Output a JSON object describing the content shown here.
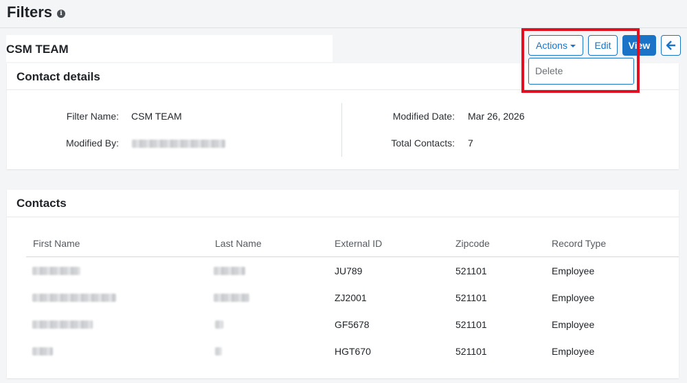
{
  "page": {
    "title": "Filters",
    "subtitle": "CSM TEAM"
  },
  "toolbar": {
    "actions_label": "Actions",
    "edit_label": "Edit",
    "view_label": "View"
  },
  "actions_menu": {
    "items": [
      "Delete"
    ]
  },
  "contact_details": {
    "title": "Contact details",
    "filter_name_label": "Filter Name:",
    "filter_name_value": "CSM TEAM",
    "modified_by_label": "Modified By:",
    "modified_date_label": "Modified Date:",
    "modified_date_value": "Mar 26, 2026",
    "total_contacts_label": "Total Contacts:",
    "total_contacts_value": "7"
  },
  "contacts": {
    "title": "Contacts",
    "columns": [
      "First Name",
      "Last Name",
      "External ID",
      "Zipcode",
      "Record Type"
    ],
    "rows": [
      {
        "external_id": "JU789",
        "zipcode": "521101",
        "record_type": "Employee"
      },
      {
        "external_id": "ZJ2001",
        "zipcode": "521101",
        "record_type": "Employee"
      },
      {
        "external_id": "GF5678",
        "zipcode": "521101",
        "record_type": "Employee"
      },
      {
        "external_id": "HGT670",
        "zipcode": "521101",
        "record_type": "Employee"
      }
    ]
  },
  "colors": {
    "primary": "#1a73c7",
    "highlight": "#e01020"
  }
}
